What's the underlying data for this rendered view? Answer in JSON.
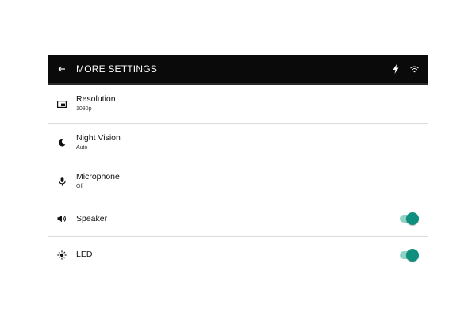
{
  "header": {
    "title": "MORE SETTINGS",
    "back_icon": "arrow-back-icon",
    "status_icons": [
      "flash-icon",
      "wifi-icon"
    ],
    "background": "#0a0a0a"
  },
  "settings": [
    {
      "label": "Resolution",
      "value": "1080p",
      "icon": "resolution-icon"
    },
    {
      "label": "Night Vision",
      "value": "Auto",
      "icon": "moon-icon"
    },
    {
      "label": "Microphone",
      "value": "Off",
      "icon": "microphone-icon"
    },
    {
      "label": "Speaker",
      "icon": "speaker-icon",
      "toggle_on": true
    },
    {
      "label": "LED",
      "icon": "led-icon",
      "toggle_on": true
    }
  ],
  "colors": {
    "toggle_track": "#8fd3c6",
    "toggle_knob": "#0f8f7d",
    "divider": "#dcdcdc"
  }
}
